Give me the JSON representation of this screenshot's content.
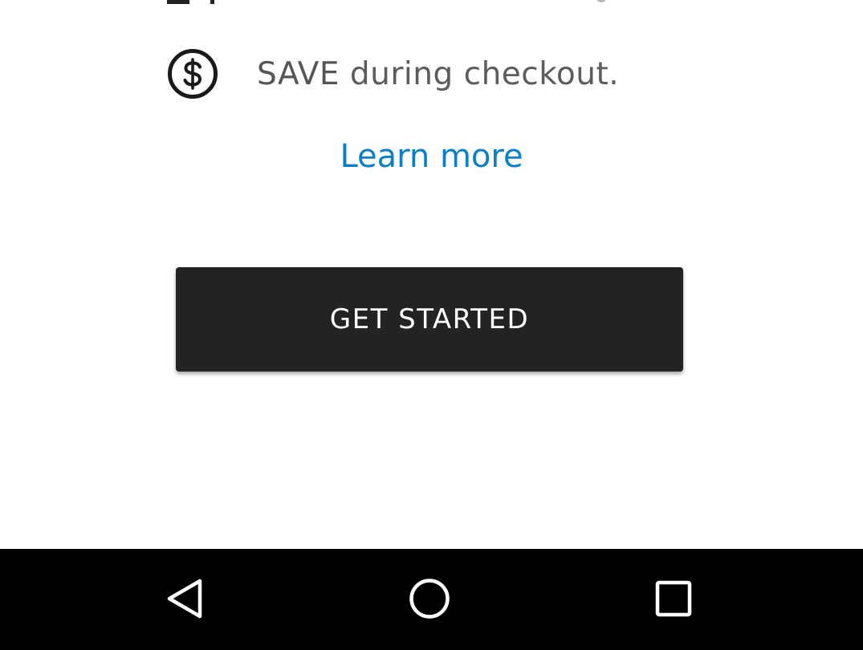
{
  "onboarding": {
    "feature": {
      "icon": "dollar-circle-icon",
      "emphasis": "SAVE",
      "text": "during checkout."
    },
    "learn_more_label": "Learn more",
    "cta_label": "GET STARTED"
  },
  "navigation_bar": {
    "back_icon": "back-triangle-icon",
    "home_icon": "home-circle-icon",
    "recents_icon": "recents-square-icon"
  },
  "colors": {
    "link": "#0b7fc7",
    "button_background": "#232323",
    "button_text": "#ffffff",
    "body_text": "#555555",
    "nav_background": "#000000"
  }
}
